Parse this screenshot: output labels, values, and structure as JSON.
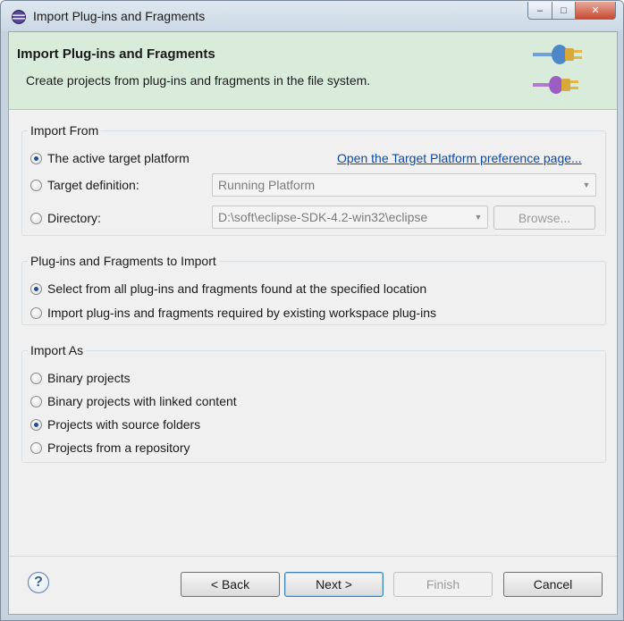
{
  "window": {
    "title": "Import Plug-ins and Fragments",
    "controls": {
      "minimize": "–",
      "maximize": "□",
      "close": "✕"
    }
  },
  "banner": {
    "title": "Import Plug-ins and Fragments",
    "description": "Create projects from plug-ins and fragments in the file system."
  },
  "import_from": {
    "legend": "Import From",
    "options": [
      {
        "label": "The active target platform",
        "selected": true
      },
      {
        "label": "Target definition:",
        "selected": false
      },
      {
        "label": "Directory:",
        "selected": false
      }
    ],
    "preference_link": "Open the Target Platform preference page...",
    "target_definition_value": "Running Platform",
    "directory_value": "D:\\soft\\eclipse-SDK-4.2-win32\\eclipse",
    "browse_label": "Browse..."
  },
  "to_import": {
    "legend": "Plug-ins and Fragments to Import",
    "options": [
      {
        "label": "Select from all plug-ins and fragments found at the specified location",
        "selected": true
      },
      {
        "label": "Import plug-ins and fragments required by existing workspace plug-ins",
        "selected": false
      }
    ]
  },
  "import_as": {
    "legend": "Import As",
    "options": [
      {
        "label": "Binary projects",
        "selected": false
      },
      {
        "label": "Binary projects with linked content",
        "selected": false
      },
      {
        "label": "Projects with source folders",
        "selected": true
      },
      {
        "label": "Projects from a repository",
        "selected": false
      }
    ]
  },
  "buttons": {
    "help": "?",
    "back": "< Back",
    "next": "Next >",
    "finish": "Finish",
    "cancel": "Cancel"
  }
}
